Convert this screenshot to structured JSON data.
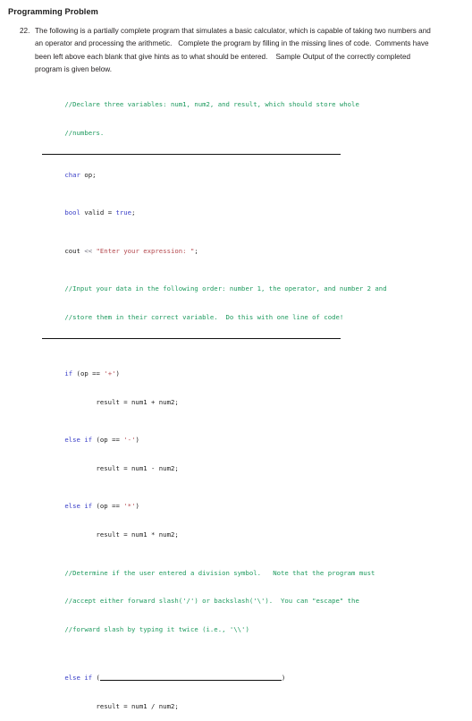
{
  "document": {
    "heading": "Programming Problem",
    "problem": {
      "number": "22.",
      "text": "The following is a partially complete program that simulates a basic calculator, which is capable of taking two numbers and an operator and processing the arithmetic.   Complete the program by filling in the missing lines of code.  Comments have been left above each blank that give hints as to what should be entered.    Sample Output of the correctly completed program is given below."
    },
    "code": {
      "comment_declare_1": "//Declare three variables: num1, num2, and result, which should store whole",
      "comment_declare_2": "//numbers.",
      "char_kw": "char",
      "char_rest": " op;",
      "bool_kw": "bool",
      "bool_name": " valid = ",
      "bool_true": "true",
      "bool_semi": ";",
      "cout_name": "cout",
      "cout_op": " << ",
      "cout_str": "\"Enter your expression: \"",
      "cout_semi": ";",
      "comment_input_1": "//Input your data in the following order: number 1, the operator, and number 2 and",
      "comment_input_2": "//store them in their correct variable.  Do this with one line of code!",
      "if_kw": "if",
      "if_cond_open": " (op == ",
      "if_char_plus": "'+'",
      "if_cond_close": ")",
      "if_body": "        result = num1 + num2;",
      "elseif1_kw": "else if",
      "elseif1_cond_open": " (op == ",
      "elseif1_char": "'-'",
      "elseif1_cond_close": ")",
      "elseif1_body": "        result = num1 - num2;",
      "elseif2_kw": "else if",
      "elseif2_cond_open": " (op == ",
      "elseif2_char": "'*'",
      "elseif2_cond_close": ")",
      "elseif2_body": "        result = num1 * num2;",
      "comment_div_1": "//Determine if the user entered a division symbol.   Note that the program must",
      "comment_div_2": "//accept either forward slash('/') or backslash('\\').  You can \"escape\" the",
      "comment_div_3": "//forward slash by typing it twice (i.e., '\\\\')",
      "elseif3_kw": "else if",
      "elseif3_paren_open": " (",
      "elseif3_paren_close": ")",
      "elseif3_body": "        result = num1 / num2;"
    }
  },
  "colors": {
    "comment": "#1d9a5e",
    "keyword": "#3b40c8",
    "string": "#b4484e",
    "plain": "#1c1c1c",
    "operator": "#6b6b7a",
    "rule": "#111111",
    "background": "#ffffff"
  }
}
